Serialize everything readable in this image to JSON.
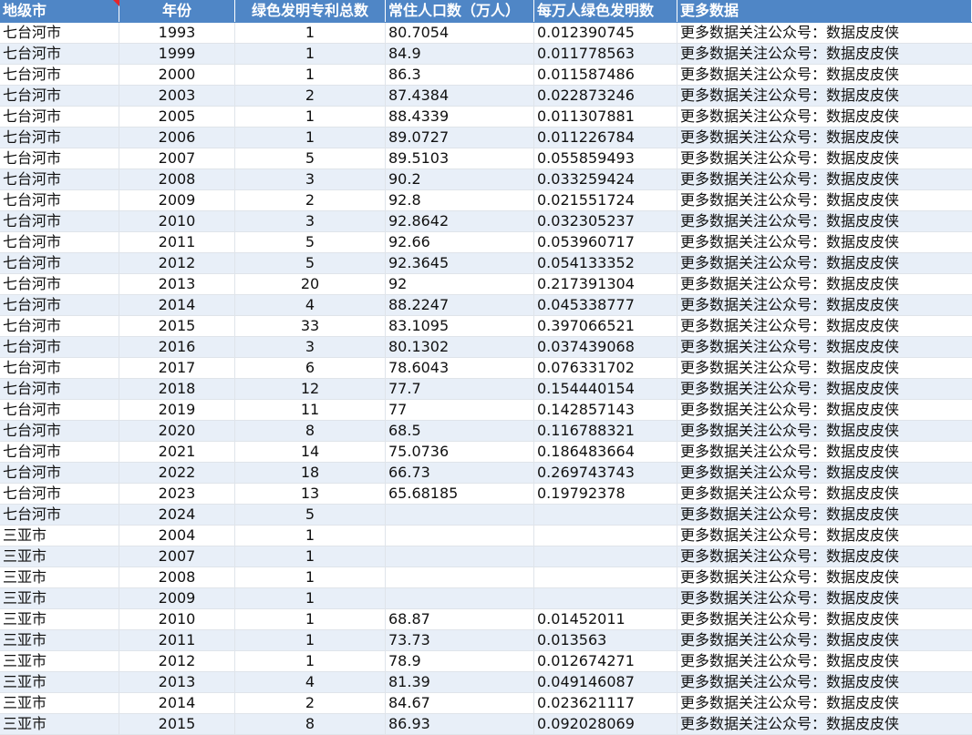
{
  "header": {
    "columns": [
      "地级市",
      "年份",
      "绿色发明专利总数",
      "常住人口数（万人）",
      "每万人绿色发明数",
      "更多数据"
    ]
  },
  "rows": [
    [
      "七台河市",
      "1993",
      "1",
      "80.7054",
      "0.012390745",
      "更多数据关注公众号：数据皮皮侠"
    ],
    [
      "七台河市",
      "1999",
      "1",
      "84.9",
      "0.011778563",
      "更多数据关注公众号：数据皮皮侠"
    ],
    [
      "七台河市",
      "2000",
      "1",
      "86.3",
      "0.011587486",
      "更多数据关注公众号：数据皮皮侠"
    ],
    [
      "七台河市",
      "2003",
      "2",
      "87.4384",
      "0.022873246",
      "更多数据关注公众号：数据皮皮侠"
    ],
    [
      "七台河市",
      "2005",
      "1",
      "88.4339",
      "0.011307881",
      "更多数据关注公众号：数据皮皮侠"
    ],
    [
      "七台河市",
      "2006",
      "1",
      "89.0727",
      "0.011226784",
      "更多数据关注公众号：数据皮皮侠"
    ],
    [
      "七台河市",
      "2007",
      "5",
      "89.5103",
      "0.055859493",
      "更多数据关注公众号：数据皮皮侠"
    ],
    [
      "七台河市",
      "2008",
      "3",
      "90.2",
      "0.033259424",
      "更多数据关注公众号：数据皮皮侠"
    ],
    [
      "七台河市",
      "2009",
      "2",
      "92.8",
      "0.021551724",
      "更多数据关注公众号：数据皮皮侠"
    ],
    [
      "七台河市",
      "2010",
      "3",
      "92.8642",
      "0.032305237",
      "更多数据关注公众号：数据皮皮侠"
    ],
    [
      "七台河市",
      "2011",
      "5",
      "92.66",
      "0.053960717",
      "更多数据关注公众号：数据皮皮侠"
    ],
    [
      "七台河市",
      "2012",
      "5",
      "92.3645",
      "0.054133352",
      "更多数据关注公众号：数据皮皮侠"
    ],
    [
      "七台河市",
      "2013",
      "20",
      "92",
      "0.217391304",
      "更多数据关注公众号：数据皮皮侠"
    ],
    [
      "七台河市",
      "2014",
      "4",
      "88.2247",
      "0.045338777",
      "更多数据关注公众号：数据皮皮侠"
    ],
    [
      "七台河市",
      "2015",
      "33",
      "83.1095",
      "0.397066521",
      "更多数据关注公众号：数据皮皮侠"
    ],
    [
      "七台河市",
      "2016",
      "3",
      "80.1302",
      "0.037439068",
      "更多数据关注公众号：数据皮皮侠"
    ],
    [
      "七台河市",
      "2017",
      "6",
      "78.6043",
      "0.076331702",
      "更多数据关注公众号：数据皮皮侠"
    ],
    [
      "七台河市",
      "2018",
      "12",
      "77.7",
      "0.154440154",
      "更多数据关注公众号：数据皮皮侠"
    ],
    [
      "七台河市",
      "2019",
      "11",
      "77",
      "0.142857143",
      "更多数据关注公众号：数据皮皮侠"
    ],
    [
      "七台河市",
      "2020",
      "8",
      "68.5",
      "0.116788321",
      "更多数据关注公众号：数据皮皮侠"
    ],
    [
      "七台河市",
      "2021",
      "14",
      "75.0736",
      "0.186483664",
      "更多数据关注公众号：数据皮皮侠"
    ],
    [
      "七台河市",
      "2022",
      "18",
      "66.73",
      "0.269743743",
      "更多数据关注公众号：数据皮皮侠"
    ],
    [
      "七台河市",
      "2023",
      "13",
      "65.68185",
      "0.19792378",
      "更多数据关注公众号：数据皮皮侠"
    ],
    [
      "七台河市",
      "2024",
      "5",
      "",
      "",
      "更多数据关注公众号：数据皮皮侠"
    ],
    [
      "三亚市",
      "2004",
      "1",
      "",
      "",
      "更多数据关注公众号：数据皮皮侠"
    ],
    [
      "三亚市",
      "2007",
      "1",
      "",
      "",
      "更多数据关注公众号：数据皮皮侠"
    ],
    [
      "三亚市",
      "2008",
      "1",
      "",
      "",
      "更多数据关注公众号：数据皮皮侠"
    ],
    [
      "三亚市",
      "2009",
      "1",
      "",
      "",
      "更多数据关注公众号：数据皮皮侠"
    ],
    [
      "三亚市",
      "2010",
      "1",
      "68.87",
      "0.01452011",
      "更多数据关注公众号：数据皮皮侠"
    ],
    [
      "三亚市",
      "2011",
      "1",
      "73.73",
      "0.013563",
      "更多数据关注公众号：数据皮皮侠"
    ],
    [
      "三亚市",
      "2012",
      "1",
      "78.9",
      "0.012674271",
      "更多数据关注公众号：数据皮皮侠"
    ],
    [
      "三亚市",
      "2013",
      "4",
      "81.39",
      "0.049146087",
      "更多数据关注公众号：数据皮皮侠"
    ],
    [
      "三亚市",
      "2014",
      "2",
      "84.67",
      "0.023621117",
      "更多数据关注公众号：数据皮皮侠"
    ],
    [
      "三亚市",
      "2015",
      "8",
      "86.93",
      "0.092028069",
      "更多数据关注公众号：数据皮皮侠"
    ]
  ],
  "colors": {
    "header_bg": "#4f86c6",
    "band_bg": "#e8eff8",
    "comment_flag": "#e5262b"
  }
}
